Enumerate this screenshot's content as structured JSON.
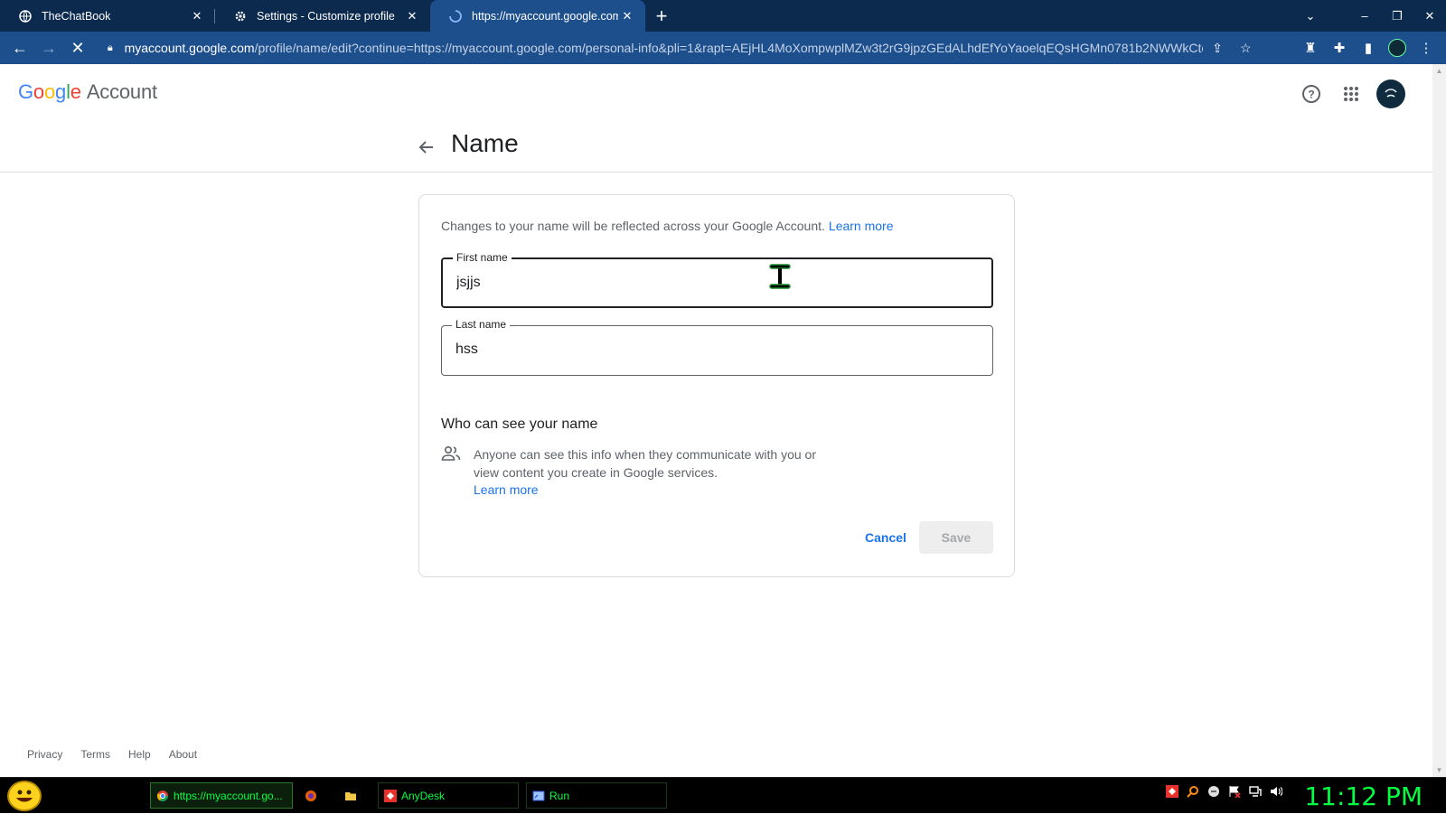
{
  "browser": {
    "tabs": [
      {
        "title": "TheChatBook",
        "icon": "globe-icon",
        "active": false
      },
      {
        "title": "Settings - Customize profile",
        "icon": "gear-icon",
        "active": false
      },
      {
        "title": "https://myaccount.google.com/p",
        "icon": "loading-spinner-icon",
        "active": true
      }
    ],
    "new_tab": "+",
    "url_host": "myaccount.google.com",
    "url_rest": "/profile/name/edit?continue=https://myaccount.google.com/personal-info&pli=1&rapt=AEjHL4MoXompwplMZw3t2rG9jpzGEdALhdEfYoYaoelqEQsHGMn0781b2NWWkCto..."
  },
  "header": {
    "logo_word": "Google",
    "logo_suffix": "Account"
  },
  "page": {
    "title": "Name"
  },
  "form": {
    "intro": "Changes to your name will be reflected across your Google Account.",
    "intro_link": "Learn more",
    "first_name_label": "First name",
    "first_name_value": "jsjjs",
    "last_name_label": "Last name",
    "last_name_value": "hss",
    "who_title": "Who can see your name",
    "who_text": "Anyone can see this info when they communicate with you or view content you create in Google services.",
    "who_link": "Learn more",
    "cancel": "Cancel",
    "save": "Save"
  },
  "footer": {
    "links": [
      "Privacy",
      "Terms",
      "Help",
      "About"
    ]
  },
  "taskbar": {
    "items": [
      {
        "label": "https://myaccount.go..."
      },
      {
        "label": ""
      },
      {
        "label": ""
      },
      {
        "label": "AnyDesk"
      },
      {
        "label": "Run"
      }
    ],
    "clock": "11:12 PM"
  },
  "colors": {
    "accent_blue": "#1a73e8",
    "tabbar_bg": "#0b2a4e",
    "toolbar_bg": "#1d4f8d",
    "taskbar_text": "#00ff41"
  }
}
